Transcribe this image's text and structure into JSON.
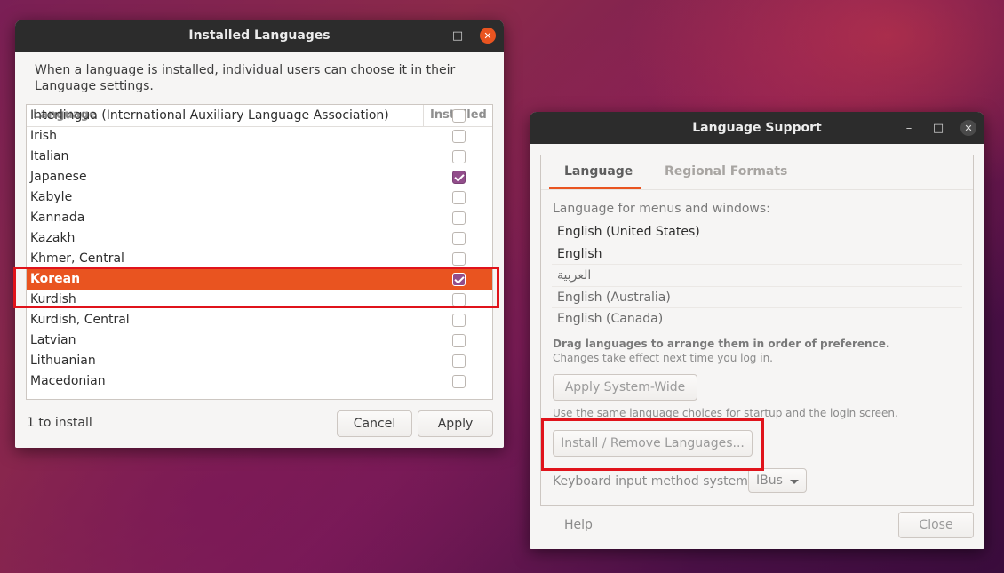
{
  "installed_window": {
    "title": "Installed Languages",
    "description": "When a language is installed, individual users can choose it in their Language settings.",
    "columns": {
      "language": "Language",
      "installed": "Installed"
    },
    "rows": [
      {
        "name": "Interlingua (International Auxiliary Language Association)",
        "installed": false
      },
      {
        "name": "Irish",
        "installed": false
      },
      {
        "name": "Italian",
        "installed": false
      },
      {
        "name": "Japanese",
        "installed": true
      },
      {
        "name": "Kabyle",
        "installed": false
      },
      {
        "name": "Kannada",
        "installed": false
      },
      {
        "name": "Kazakh",
        "installed": false
      },
      {
        "name": "Khmer, Central",
        "installed": false
      },
      {
        "name": "Korean",
        "installed": true,
        "selected": true
      },
      {
        "name": "Kurdish",
        "installed": false
      },
      {
        "name": "Kurdish, Central",
        "installed": false
      },
      {
        "name": "Latvian",
        "installed": false
      },
      {
        "name": "Lithuanian",
        "installed": false
      },
      {
        "name": "Macedonian",
        "installed": false
      }
    ],
    "status": "1 to install",
    "cancel_label": "Cancel",
    "apply_label": "Apply",
    "minimize_icon": "minimize-icon",
    "maximize_icon": "maximize-icon",
    "close_icon": "close-icon"
  },
  "support_window": {
    "title": "Language Support",
    "tabs": [
      "Language",
      "Regional Formats"
    ],
    "active_tab": "Language",
    "pref_label": "Language for menus and windows:",
    "pref_languages": [
      "English (United States)",
      "English",
      "العربية",
      "English (Australia)",
      "English (Canada)"
    ],
    "drag_hint": "Drag languages to arrange them in order of preference.",
    "effect_hint": "Changes take effect next time you log in.",
    "apply_system_wide_label": "Apply System-Wide",
    "system_wide_hint": "Use the same language choices for startup and the login screen.",
    "install_remove_label": "Install / Remove Languages...",
    "keyboard_label": "Keyboard input method system:",
    "keyboard_value": "IBus",
    "help_label": "Help",
    "close_label": "Close"
  },
  "colors": {
    "accent": "#e95420",
    "checkbox_checked": "#924d8b",
    "highlight_box": "#e0131b",
    "titlebar": "#2c2c2c"
  }
}
